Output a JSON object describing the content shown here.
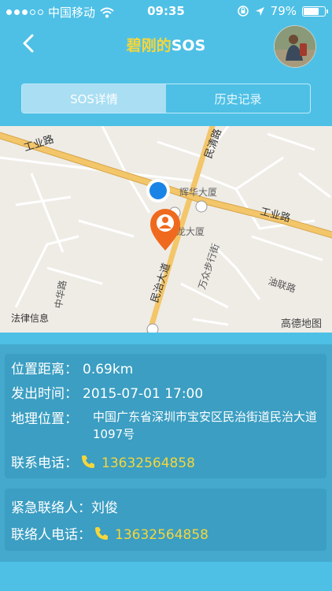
{
  "status_bar": {
    "carrier": "中国移动",
    "time": "09:35",
    "battery_text": "79%",
    "battery_level": 0.79,
    "icons": [
      "signal-dots-icon",
      "wifi-icon",
      "orientation-lock-icon",
      "location-arrow-icon",
      "battery-icon"
    ]
  },
  "nav": {
    "title_name": "碧刚的",
    "title_suffix": "SOS",
    "back_icon": "chevron-left-icon"
  },
  "tabs": [
    {
      "label": "SOS详情",
      "active": true
    },
    {
      "label": "历史记录",
      "active": false
    }
  ],
  "map": {
    "labels": {
      "road1": "工业路",
      "road2": "民清路",
      "road3": "工业路",
      "road4": "民治大道",
      "road5": "万众步行街",
      "road6": "油联路",
      "road7": "中华路",
      "poi1": "辉华大厦",
      "poi2": "腾龙大厦"
    },
    "legal_link": "法律信息",
    "provider": "高德地图",
    "markers": [
      "current-location-dot",
      "person-pin-icon"
    ]
  },
  "details": {
    "distance_label": "位置距离：",
    "distance_value": "0.69km",
    "time_label": "发出时间：",
    "time_value": "2015-07-01 17:00",
    "location_label": "地理位置：",
    "location_value": "中国广东省深圳市宝安区民治街道民治大道1097号",
    "phone_label": "联系电话：",
    "phone_value": "13632564858"
  },
  "emergency": {
    "contact_label": "紧急联络人：",
    "contact_value": "刘俊",
    "phone_label": "联络人电话：",
    "phone_value": "13632564858"
  },
  "colors": {
    "background": "#4ec0e6",
    "accent_yellow": "#f5d63b",
    "card": "#3b9ec2",
    "pin_orange": "#ef6a1e",
    "location_blue": "#1a84e6"
  }
}
